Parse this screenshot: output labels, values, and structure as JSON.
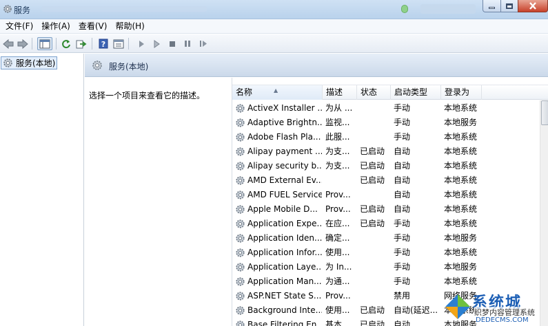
{
  "window": {
    "title": "服务"
  },
  "menu": [
    {
      "label": "文件(F)"
    },
    {
      "label": "操作(A)"
    },
    {
      "label": "查看(V)"
    },
    {
      "label": "帮助(H)"
    }
  ],
  "tree": {
    "selected": "服务(本地)"
  },
  "pane": {
    "title": "服务(本地)",
    "description": "选择一个项目来查看它的描述。"
  },
  "columns": {
    "name": "名称",
    "desc": "描述",
    "state": "状态",
    "startup": "启动类型",
    "logon": "登录为"
  },
  "services": [
    {
      "name": "ActiveX Installer ...",
      "desc": "为从 ...",
      "state": "",
      "startup": "手动",
      "logon": "本地系统"
    },
    {
      "name": "Adaptive Brightn...",
      "desc": "监视...",
      "state": "",
      "startup": "手动",
      "logon": "本地服务"
    },
    {
      "name": "Adobe Flash Pla...",
      "desc": "此服...",
      "state": "",
      "startup": "手动",
      "logon": "本地系统"
    },
    {
      "name": "Alipay payment ...",
      "desc": "为支...",
      "state": "已启动",
      "startup": "自动",
      "logon": "本地系统"
    },
    {
      "name": "Alipay security b...",
      "desc": "为支...",
      "state": "已启动",
      "startup": "自动",
      "logon": "本地系统"
    },
    {
      "name": "AMD External Ev...",
      "desc": "",
      "state": "已启动",
      "startup": "自动",
      "logon": "本地系统"
    },
    {
      "name": "AMD FUEL Service",
      "desc": "Prov...",
      "state": "",
      "startup": "自动",
      "logon": "本地系统"
    },
    {
      "name": "Apple Mobile D...",
      "desc": "Prov...",
      "state": "已启动",
      "startup": "自动",
      "logon": "本地系统"
    },
    {
      "name": "Application Expe...",
      "desc": "在应...",
      "state": "已启动",
      "startup": "手动",
      "logon": "本地系统"
    },
    {
      "name": "Application Iden...",
      "desc": "确定...",
      "state": "",
      "startup": "手动",
      "logon": "本地服务"
    },
    {
      "name": "Application Infor...",
      "desc": "使用...",
      "state": "",
      "startup": "手动",
      "logon": "本地系统"
    },
    {
      "name": "Application Laye...",
      "desc": "为 In...",
      "state": "",
      "startup": "手动",
      "logon": "本地服务"
    },
    {
      "name": "Application Man...",
      "desc": "为通...",
      "state": "",
      "startup": "手动",
      "logon": "本地系统"
    },
    {
      "name": "ASP.NET State S...",
      "desc": "Prov...",
      "state": "",
      "startup": "禁用",
      "logon": "网络服务"
    },
    {
      "name": "Background Inte...",
      "desc": "使用...",
      "state": "已启动",
      "startup": "自动(延迟...",
      "logon": "本地系统"
    },
    {
      "name": "Base Filtering En...",
      "desc": "基本...",
      "state": "已启动",
      "startup": "自动",
      "logon": "本地服务"
    }
  ],
  "watermark": {
    "main": "系统城",
    "sub": "织梦内容管理系统",
    "url": "DEDECMS.COM"
  },
  "icons": {
    "app": "gear-icon",
    "back": "back-arrow-icon",
    "forward": "forward-arrow-icon",
    "console": "console-tree-icon",
    "refresh": "refresh-icon",
    "export": "export-list-icon",
    "help": "help-icon",
    "properties": "properties-icon",
    "start": "play-icon",
    "start-alt": "play-outline-icon",
    "stop": "stop-icon",
    "pause": "pause-icon",
    "resume": "resume-icon",
    "service": "gear-icon"
  }
}
